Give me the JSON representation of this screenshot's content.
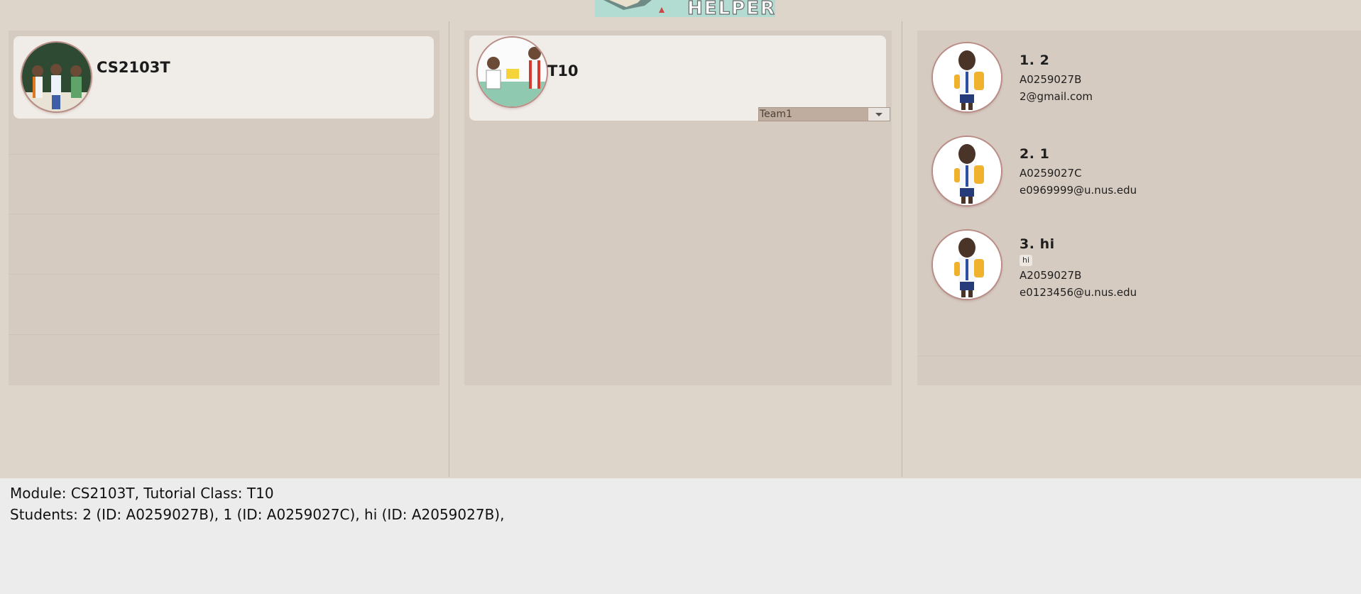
{
  "app": {
    "logo_text": "HELPER"
  },
  "modules": {
    "items": [
      {
        "code": "CS2103T"
      }
    ]
  },
  "classes": {
    "items": [
      {
        "name": "T10",
        "team_selected": "Team1"
      }
    ]
  },
  "students": {
    "items": [
      {
        "index": "1.",
        "name": "2",
        "id": "A0259027B",
        "email": "2@gmail.com",
        "tags": []
      },
      {
        "index": "2.",
        "name": "1",
        "id": "A0259027C",
        "email": "e0969999@u.nus.edu",
        "tags": []
      },
      {
        "index": "3.",
        "name": "hi",
        "id": "A2059027B",
        "email": "e0123456@u.nus.edu",
        "tags": [
          "hi"
        ]
      }
    ]
  },
  "result": {
    "line1": "Module: CS2103T, Tutorial Class: T10",
    "line2": "Students: 2 (ID: A0259027B), 1 (ID: A0259027C), hi (ID: A2059027B),"
  },
  "colors": {
    "background": "#ddd4ca",
    "panel": "#d6cbc1",
    "card": "#f0ece7",
    "result_box": "#ececec",
    "avatar_ring": "#b98d86"
  }
}
